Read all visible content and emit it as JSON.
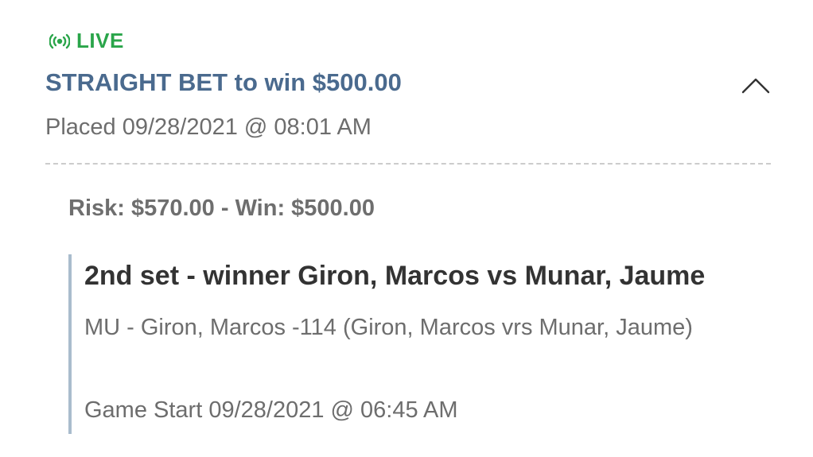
{
  "bet": {
    "live_label": "LIVE",
    "title": "STRAIGHT BET to win $500.00",
    "placed": "Placed 09/28/2021 @ 08:01 AM",
    "risk_win": "Risk: $570.00 - Win: $500.00",
    "selection": {
      "title": "2nd set - winner Giron, Marcos vs Munar, Jaume",
      "description": "MU - Giron, Marcos -114 (Giron, Marcos vrs Munar, Jaume)",
      "game_start": "Game Start 09/28/2021 @ 06:45 AM"
    }
  },
  "icons": {
    "live": "live-broadcast-icon",
    "collapse": "chevron-up-icon"
  },
  "colors": {
    "live": "#2aa54a",
    "title": "#4a6a8e",
    "accent_bar": "#a9bccd",
    "text_muted": "#6d6d6d",
    "text_dark": "#333333"
  }
}
